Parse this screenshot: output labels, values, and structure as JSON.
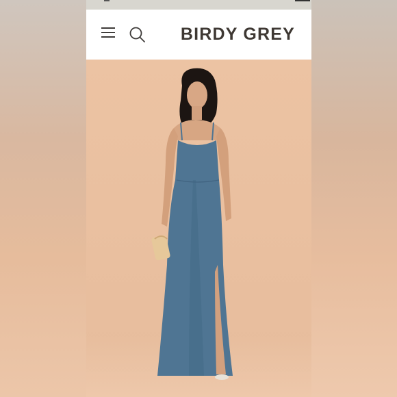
{
  "header": {
    "brand": "BIRDY GREY",
    "menu_icon": "hamburger-menu-icon",
    "search_icon": "search-icon"
  },
  "product": {
    "image": "model-in-blue-dress",
    "dress_color": "#4f7593"
  },
  "colors": {
    "background": "#e9c0a0",
    "header_bg": "#ffffff",
    "brand_text": "#3e3833"
  }
}
